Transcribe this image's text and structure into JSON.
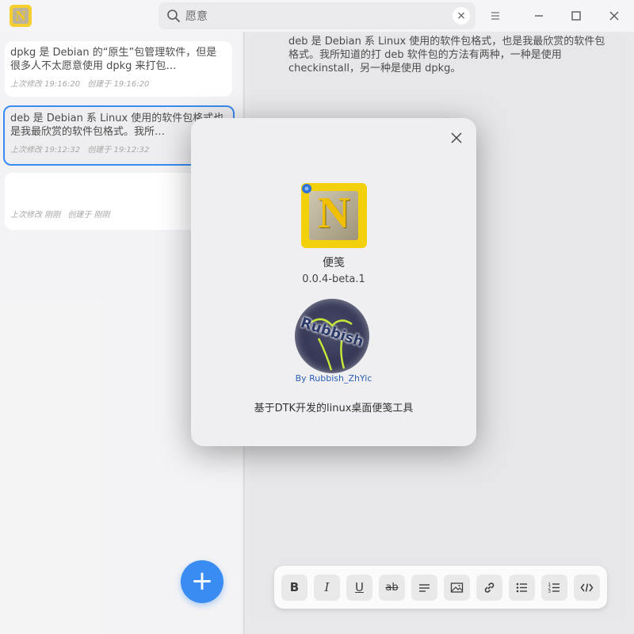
{
  "header": {
    "logo_letter": "N",
    "search": {
      "value": "愿意",
      "clear_label": "×"
    }
  },
  "notes": [
    {
      "text": "dpkg 是 Debian 的“原生”包管理软件，但是很多人不太愿意使用 dpkg 来打包…",
      "modified": "上次修改 19:16:20",
      "created": "创建于 19:16:20"
    },
    {
      "text": "deb 是 Debian 系 Linux 使用的软件包格式也是我最欣赏的软件包格式。我所…",
      "modified": "上次修改 19:12:32",
      "created": "创建于 19:12:32"
    },
    {
      "text": "",
      "modified": "上次修改 刚刚",
      "created": "创建于 刚刚"
    }
  ],
  "add_button_label": "+",
  "editor": {
    "content": "deb 是 Debian 系 Linux 使用的软件包格式，也是我最欣赏的软件包格式。我所知道的打 deb 软件包的方法有两种，一种是使用 checkinstall，另一种是使用 dpkg。"
  },
  "toolbar": {
    "bold": "B",
    "italic": "I",
    "underline": "U",
    "strike": "ab"
  },
  "about_dialog": {
    "app_name": "便笺",
    "version": "0.0.4-beta.1",
    "author_logo_text": "Rubbish",
    "author_link": "By Rubbish_ZhYic",
    "description": "基于DTK开发的linux桌面便笺工具"
  },
  "colors": {
    "accent": "#1e7df0",
    "logo_yellow": "#f3d00c"
  }
}
